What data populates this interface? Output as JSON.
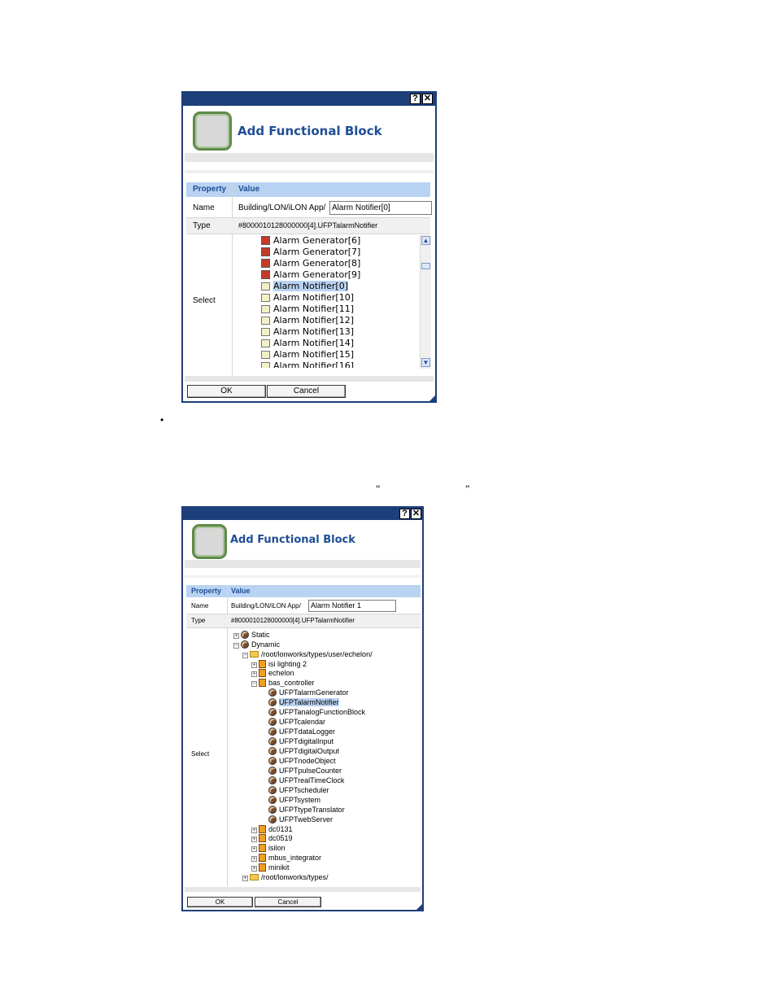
{
  "dialog1": {
    "title": "Add Functional Block",
    "help_label": "?",
    "close_label": "✕",
    "header_property": "Property",
    "header_value": "Value",
    "name_label": "Name",
    "name_path": "Building/LON/iLON App/",
    "name_value": "Alarm Notifier[0]",
    "type_label": "Type",
    "type_value": "#8000010128000000[4].UFPTalarmNotifier",
    "select_label": "Select",
    "items": [
      {
        "label": "Alarm Generator[6]",
        "icon": "alarm-generator-icon"
      },
      {
        "label": "Alarm Generator[7]",
        "icon": "alarm-generator-icon"
      },
      {
        "label": "Alarm Generator[8]",
        "icon": "alarm-generator-icon"
      },
      {
        "label": "Alarm Generator[9]",
        "icon": "alarm-generator-icon"
      },
      {
        "label": "Alarm Notifier[0]",
        "icon": "alarm-notifier-icon",
        "selected": true
      },
      {
        "label": "Alarm Notifier[10]",
        "icon": "alarm-notifier-icon"
      },
      {
        "label": "Alarm Notifier[11]",
        "icon": "alarm-notifier-icon"
      },
      {
        "label": "Alarm Notifier[12]",
        "icon": "alarm-notifier-icon"
      },
      {
        "label": "Alarm Notifier[13]",
        "icon": "alarm-notifier-icon"
      },
      {
        "label": "Alarm Notifier[14]",
        "icon": "alarm-notifier-icon"
      },
      {
        "label": "Alarm Notifier[15]",
        "icon": "alarm-notifier-icon"
      },
      {
        "label": "Alarm Notifier[16]",
        "icon": "alarm-notifier-icon"
      }
    ],
    "ok_label": "OK",
    "cancel_label": "Cancel"
  },
  "bullet": "•",
  "quote_open": "“",
  "quote_close": "”",
  "dialog2": {
    "title": "Add Functional Block",
    "help_label": "?",
    "close_label": "✕",
    "header_property": "Property",
    "header_value": "Value",
    "name_label": "Name",
    "name_path": "Building/LON/iLON App/",
    "name_value": "Alarm Notifier 1",
    "type_label": "Type",
    "type_value": "#8000010128000000[4].UFPTalarmNotifier",
    "select_label": "Select",
    "tree": [
      {
        "label": "Static",
        "level": 0,
        "toggle": "+",
        "icon": "static-icon"
      },
      {
        "label": "Dynamic",
        "level": 0,
        "toggle": "-",
        "icon": "dynamic-icon"
      },
      {
        "label": "/root/lonworks/types/user/echelon/",
        "level": 1,
        "toggle": "-",
        "icon": "folder-icon"
      },
      {
        "label": "isi lighting 2",
        "level": 2,
        "toggle": "+",
        "icon": "device-icon"
      },
      {
        "label": "echelon",
        "level": 2,
        "toggle": "+",
        "icon": "device-icon"
      },
      {
        "label": "bas_controller",
        "level": 2,
        "toggle": "-",
        "icon": "device-icon"
      },
      {
        "label": "UFPTalarmGenerator",
        "level": 3,
        "icon": "functional-block-icon"
      },
      {
        "label": "UFPTalarmNotifier",
        "level": 3,
        "icon": "functional-block-icon",
        "selected": true
      },
      {
        "label": "UFPTanalogFunctionBlock",
        "level": 3,
        "icon": "functional-block-icon"
      },
      {
        "label": "UFPTcalendar",
        "level": 3,
        "icon": "functional-block-icon"
      },
      {
        "label": "UFPTdataLogger",
        "level": 3,
        "icon": "functional-block-icon"
      },
      {
        "label": "UFPTdigitalInput",
        "level": 3,
        "icon": "functional-block-icon"
      },
      {
        "label": "UFPTdigitalOutput",
        "level": 3,
        "icon": "functional-block-icon"
      },
      {
        "label": "UFPTnodeObject",
        "level": 3,
        "icon": "functional-block-icon"
      },
      {
        "label": "UFPTpulseCounter",
        "level": 3,
        "icon": "functional-block-icon"
      },
      {
        "label": "UFPTrealTimeClock",
        "level": 3,
        "icon": "functional-block-icon"
      },
      {
        "label": "UFPTscheduler",
        "level": 3,
        "icon": "functional-block-icon"
      },
      {
        "label": "UFPTsystem",
        "level": 3,
        "icon": "functional-block-icon"
      },
      {
        "label": "UFPTtypeTranslator",
        "level": 3,
        "icon": "functional-block-icon"
      },
      {
        "label": "UFPTwebServer",
        "level": 3,
        "icon": "functional-block-icon"
      },
      {
        "label": "dc0131",
        "level": 2,
        "toggle": "+",
        "icon": "device-icon"
      },
      {
        "label": "dc0519",
        "level": 2,
        "toggle": "+",
        "icon": "device-icon"
      },
      {
        "label": "isilon",
        "level": 2,
        "toggle": "+",
        "icon": "device-icon"
      },
      {
        "label": "mbus_integrator",
        "level": 2,
        "toggle": "+",
        "icon": "device-icon"
      },
      {
        "label": "minikit",
        "level": 2,
        "toggle": "+",
        "icon": "device-icon"
      },
      {
        "label": "/root/lonworks/types/",
        "level": 1,
        "toggle": "+",
        "icon": "folder-icon"
      }
    ],
    "ok_label": "OK",
    "cancel_label": "Cancel"
  }
}
